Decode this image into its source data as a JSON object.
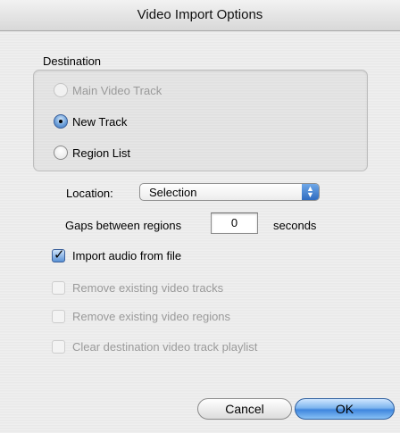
{
  "window": {
    "title": "Video Import Options"
  },
  "destination": {
    "label": "Destination",
    "options": [
      {
        "label": "Main Video Track",
        "checked": false,
        "enabled": false
      },
      {
        "label": "New Track",
        "checked": true,
        "enabled": true
      },
      {
        "label": "Region List",
        "checked": false,
        "enabled": true
      }
    ]
  },
  "location": {
    "label": "Location:",
    "value": "Selection"
  },
  "gaps": {
    "label": "Gaps between regions",
    "value": "0",
    "unit": "seconds"
  },
  "checkboxes": [
    {
      "label": "Import audio from file",
      "checked": true,
      "enabled": true
    },
    {
      "label": "Remove existing video tracks",
      "checked": false,
      "enabled": false
    },
    {
      "label": "Remove existing video regions",
      "checked": false,
      "enabled": false
    },
    {
      "label": "Clear destination video track playlist",
      "checked": false,
      "enabled": false
    }
  ],
  "buttons": {
    "cancel": "Cancel",
    "ok": "OK"
  }
}
